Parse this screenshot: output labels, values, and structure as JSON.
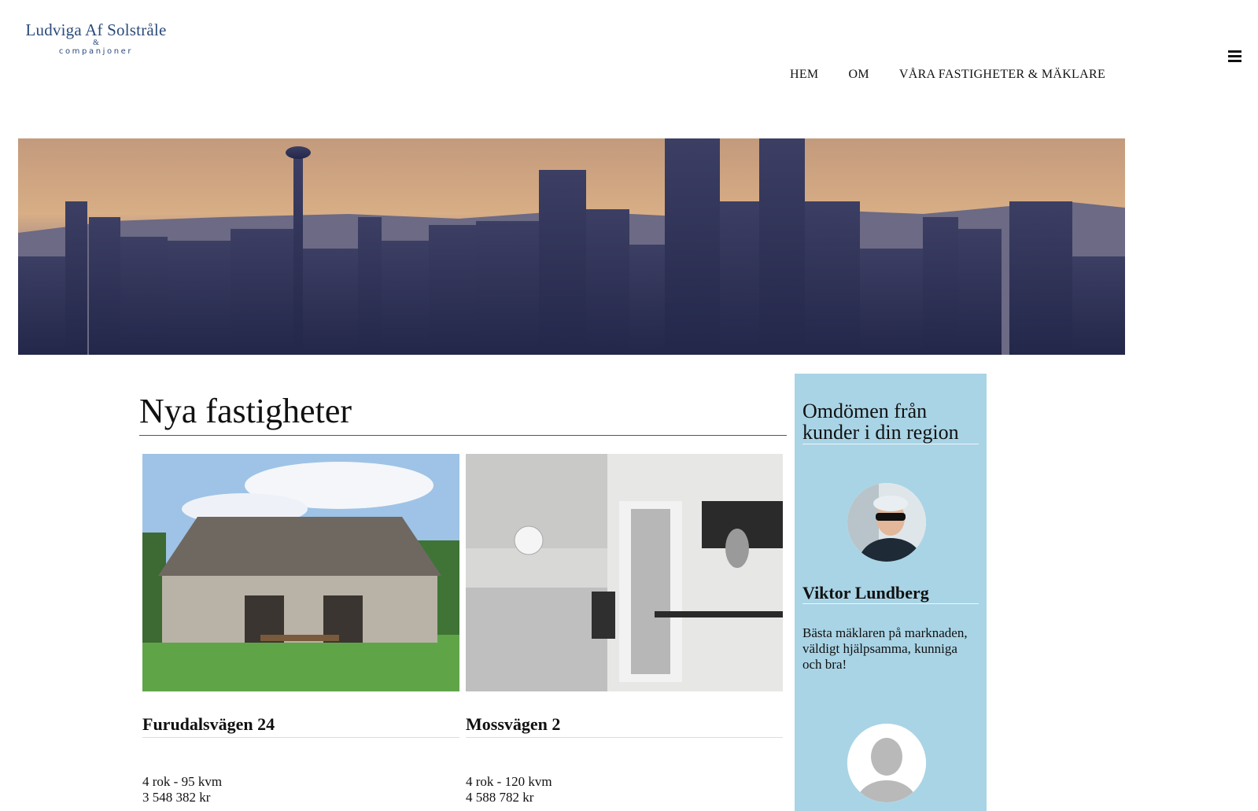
{
  "logo": {
    "name": "Ludviga Af Solstråle",
    "amp": "&",
    "sub": "companjoner",
    "color": "#2a4a7a"
  },
  "nav": {
    "items": [
      "HEM",
      "OM",
      "VÅRA FASTIGHETER & MÄKLARE"
    ]
  },
  "hero": {
    "alt": "city skyline"
  },
  "main": {
    "title": "Nya fastigheter",
    "properties": [
      {
        "name": "Furudalsvägen 24",
        "rooms": "4 rok - 95 kvm",
        "price": "3 548 382 kr"
      },
      {
        "name": "Mossvägen 2",
        "rooms": "4 rok - 120 kvm",
        "price": "4 588 782 kr"
      }
    ]
  },
  "sidebar": {
    "bg": "#a9d4e5",
    "title": "Omdömen från kunder i din region",
    "reviews": [
      {
        "name": "Viktor Lundberg",
        "text": "Bästa mäklaren på marknaden, väldigt hjälpsamma, kunniga och bra!"
      }
    ]
  }
}
